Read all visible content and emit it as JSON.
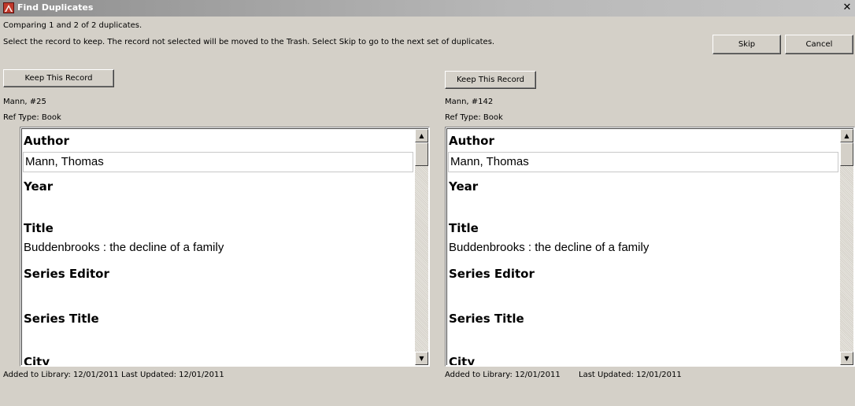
{
  "window": {
    "title": "Find Duplicates"
  },
  "header": {
    "comparing_text": "Comparing 1 and 2 of 2 duplicates.",
    "instruction_text": "Select the record to keep. The record not selected will be moved to the Trash. Select Skip to go to the next set of duplicates.",
    "skip_label": "Skip",
    "cancel_label": "Cancel"
  },
  "records": [
    {
      "keep_label": "Keep This Record",
      "id_label": "Mann, #25",
      "ref_type": "Ref Type: Book",
      "fields": {
        "author_label": "Author",
        "author_value": "Mann, Thomas",
        "year_label": "Year",
        "title_label": "Title",
        "title_value": "Buddenbrooks : the decline of a family",
        "series_editor_label": "Series Editor",
        "series_title_label": "Series Title",
        "city_label": "City"
      },
      "added": "Added to Library: 12/01/2011",
      "updated": "Last Updated: 12/01/2011"
    },
    {
      "keep_label": "Keep This Record",
      "id_label": "Mann, #142",
      "ref_type": "Ref Type: Book",
      "fields": {
        "author_label": "Author",
        "author_value": "Mann, Thomas",
        "year_label": "Year",
        "title_label": "Title",
        "title_value": "Buddenbrooks : the decline of a family",
        "series_editor_label": "Series Editor",
        "series_title_label": "Series Title",
        "city_label": "City"
      },
      "added": "Added to Library: 12/01/2011",
      "updated": "Last Updated: 12/01/2011"
    }
  ],
  "icons": {
    "close": "close-icon",
    "app": "app-icon",
    "scroll_up": "scroll-up-arrow-icon",
    "scroll_down": "scroll-down-arrow-icon"
  },
  "colors": {
    "window_bg": "#d4d0c8",
    "titlebar": "#a8a8a8",
    "pane_bg": "#ffffff"
  }
}
